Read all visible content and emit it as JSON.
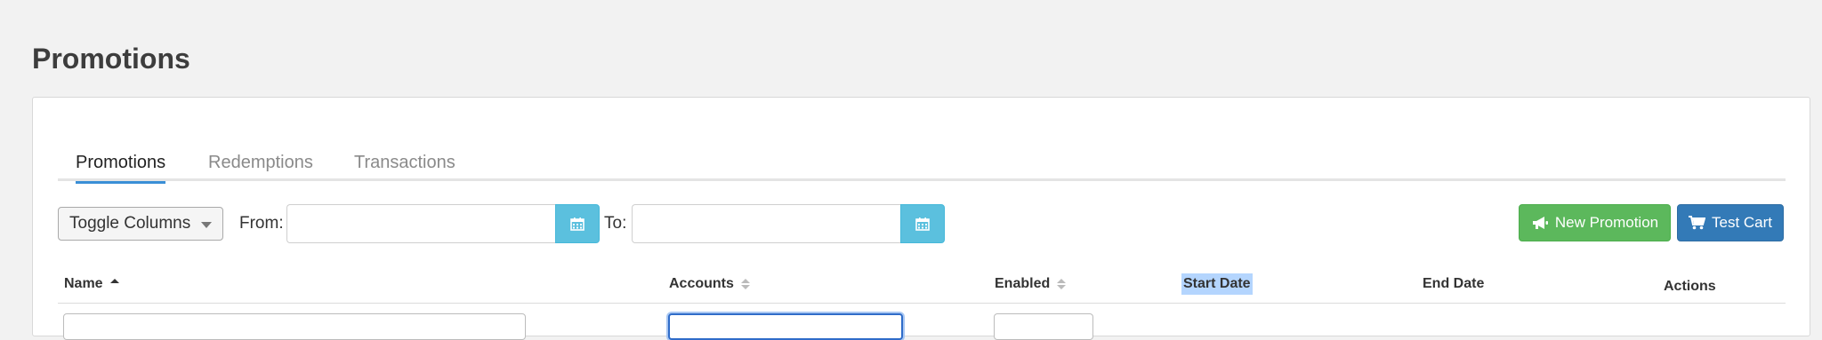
{
  "page": {
    "title": "Promotions"
  },
  "tabs": [
    {
      "label": "Promotions",
      "active": true
    },
    {
      "label": "Redemptions",
      "active": false
    },
    {
      "label": "Transactions",
      "active": false
    }
  ],
  "toolbar": {
    "toggle_columns_label": "Toggle Columns",
    "from_label": "From:",
    "from_value": "",
    "to_label": "To:",
    "to_value": "",
    "new_promotion_label": "New Promotion",
    "test_cart_label": "Test Cart"
  },
  "table": {
    "columns": [
      {
        "label": "Name",
        "sort": "asc"
      },
      {
        "label": "Accounts",
        "sort": "none"
      },
      {
        "label": "Enabled",
        "sort": "none"
      },
      {
        "label": "Start Date",
        "sort": null,
        "selected": true
      },
      {
        "label": "End Date",
        "sort": null
      },
      {
        "label": "Actions",
        "sort": null
      }
    ]
  },
  "colors": {
    "accent_tab": "#3a8fd6",
    "calendar_button": "#5bc0de",
    "new_promotion": "#5cb85c",
    "test_cart": "#337ab7",
    "selection": "#b4d5fe"
  },
  "icons": {
    "calendar": "calendar-icon",
    "megaphone": "bullhorn-icon",
    "cart": "shopping-cart-icon"
  }
}
